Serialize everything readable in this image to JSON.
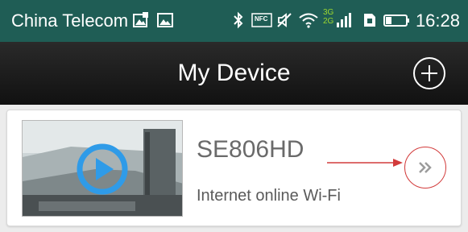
{
  "status_bar": {
    "carrier": "China Telecom",
    "time": "16:28",
    "icons": [
      "gallery-icon",
      "image-icon",
      "bluetooth-icon",
      "nfc-icon",
      "mute-icon",
      "wifi-icon",
      "signal-icon",
      "sim-icon",
      "battery-icon"
    ],
    "nfc_label": "NFC",
    "network_label": "3G 2G",
    "background_color": "#1f5d55"
  },
  "header": {
    "title": "My Device",
    "add_button": "plus-icon"
  },
  "devices": [
    {
      "name": "SE806HD",
      "status": "Internet online Wi-Fi",
      "thumbnail_icon": "play-icon",
      "detail_icon": "double-chevron-right-icon"
    }
  ],
  "colors": {
    "accent_play": "#2f9be8",
    "annotation": "#d23b3b",
    "title_bar": "#111111"
  }
}
